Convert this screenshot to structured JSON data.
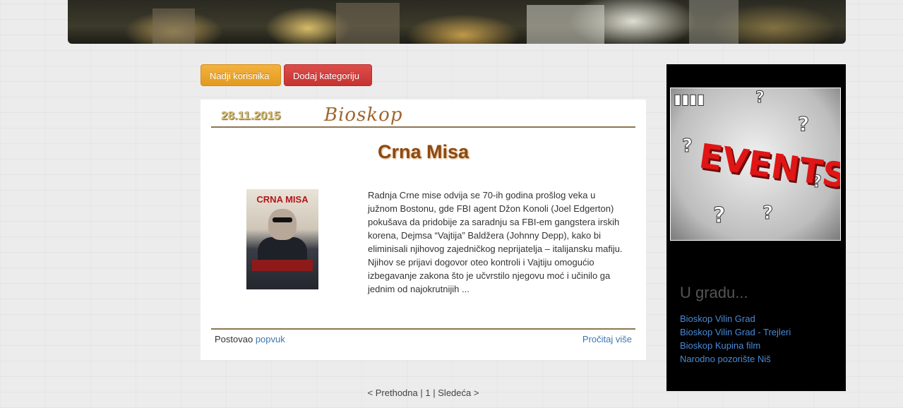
{
  "toolbar": {
    "find_users_label": "Nadji korisnika",
    "add_category_label": "Dodaj kategoriju"
  },
  "post": {
    "date": "28.11.2015",
    "category": "Bioskop",
    "title": "Crna Misa",
    "poster_title": "CRNA MISA",
    "excerpt": "Radnja Crne mise odvija se 70-ih godina prošlog veka u južnom Bostonu, gde FBI agent Džon Konoli (Joel Edgerton) pokušava da pridobije za saradnju sa FBI-em gangstera irskih korena, Dejmsa “Vajtija” Baldžera (Johnny Depp), kako bi eliminisali njihovog zajedničkog neprijatelja – italijansku mafiju. Njihov se prijavi dogovor oteo kontroli i Vajtiju omogućio izbegavanje zakona što je učvrstilo njegovu moć i učinilo ga jednim od najokrutnijih ...",
    "posted_by_label": "Postovao",
    "author": "popvuk",
    "read_more_label": "Pročitaj više"
  },
  "pagination": {
    "prev_label": "< Prethodna",
    "separator": "|",
    "current_page": "1",
    "next_label": "Sledeća >"
  },
  "sidebar": {
    "events_image_label": "EVENTS",
    "heading": "U gradu...",
    "links": [
      "Bioskop Vilin Grad",
      "Bioskop Vilin Grad - Trejleri",
      "Bioskop Kupina film",
      "Narodno pozorište Niš"
    ]
  }
}
